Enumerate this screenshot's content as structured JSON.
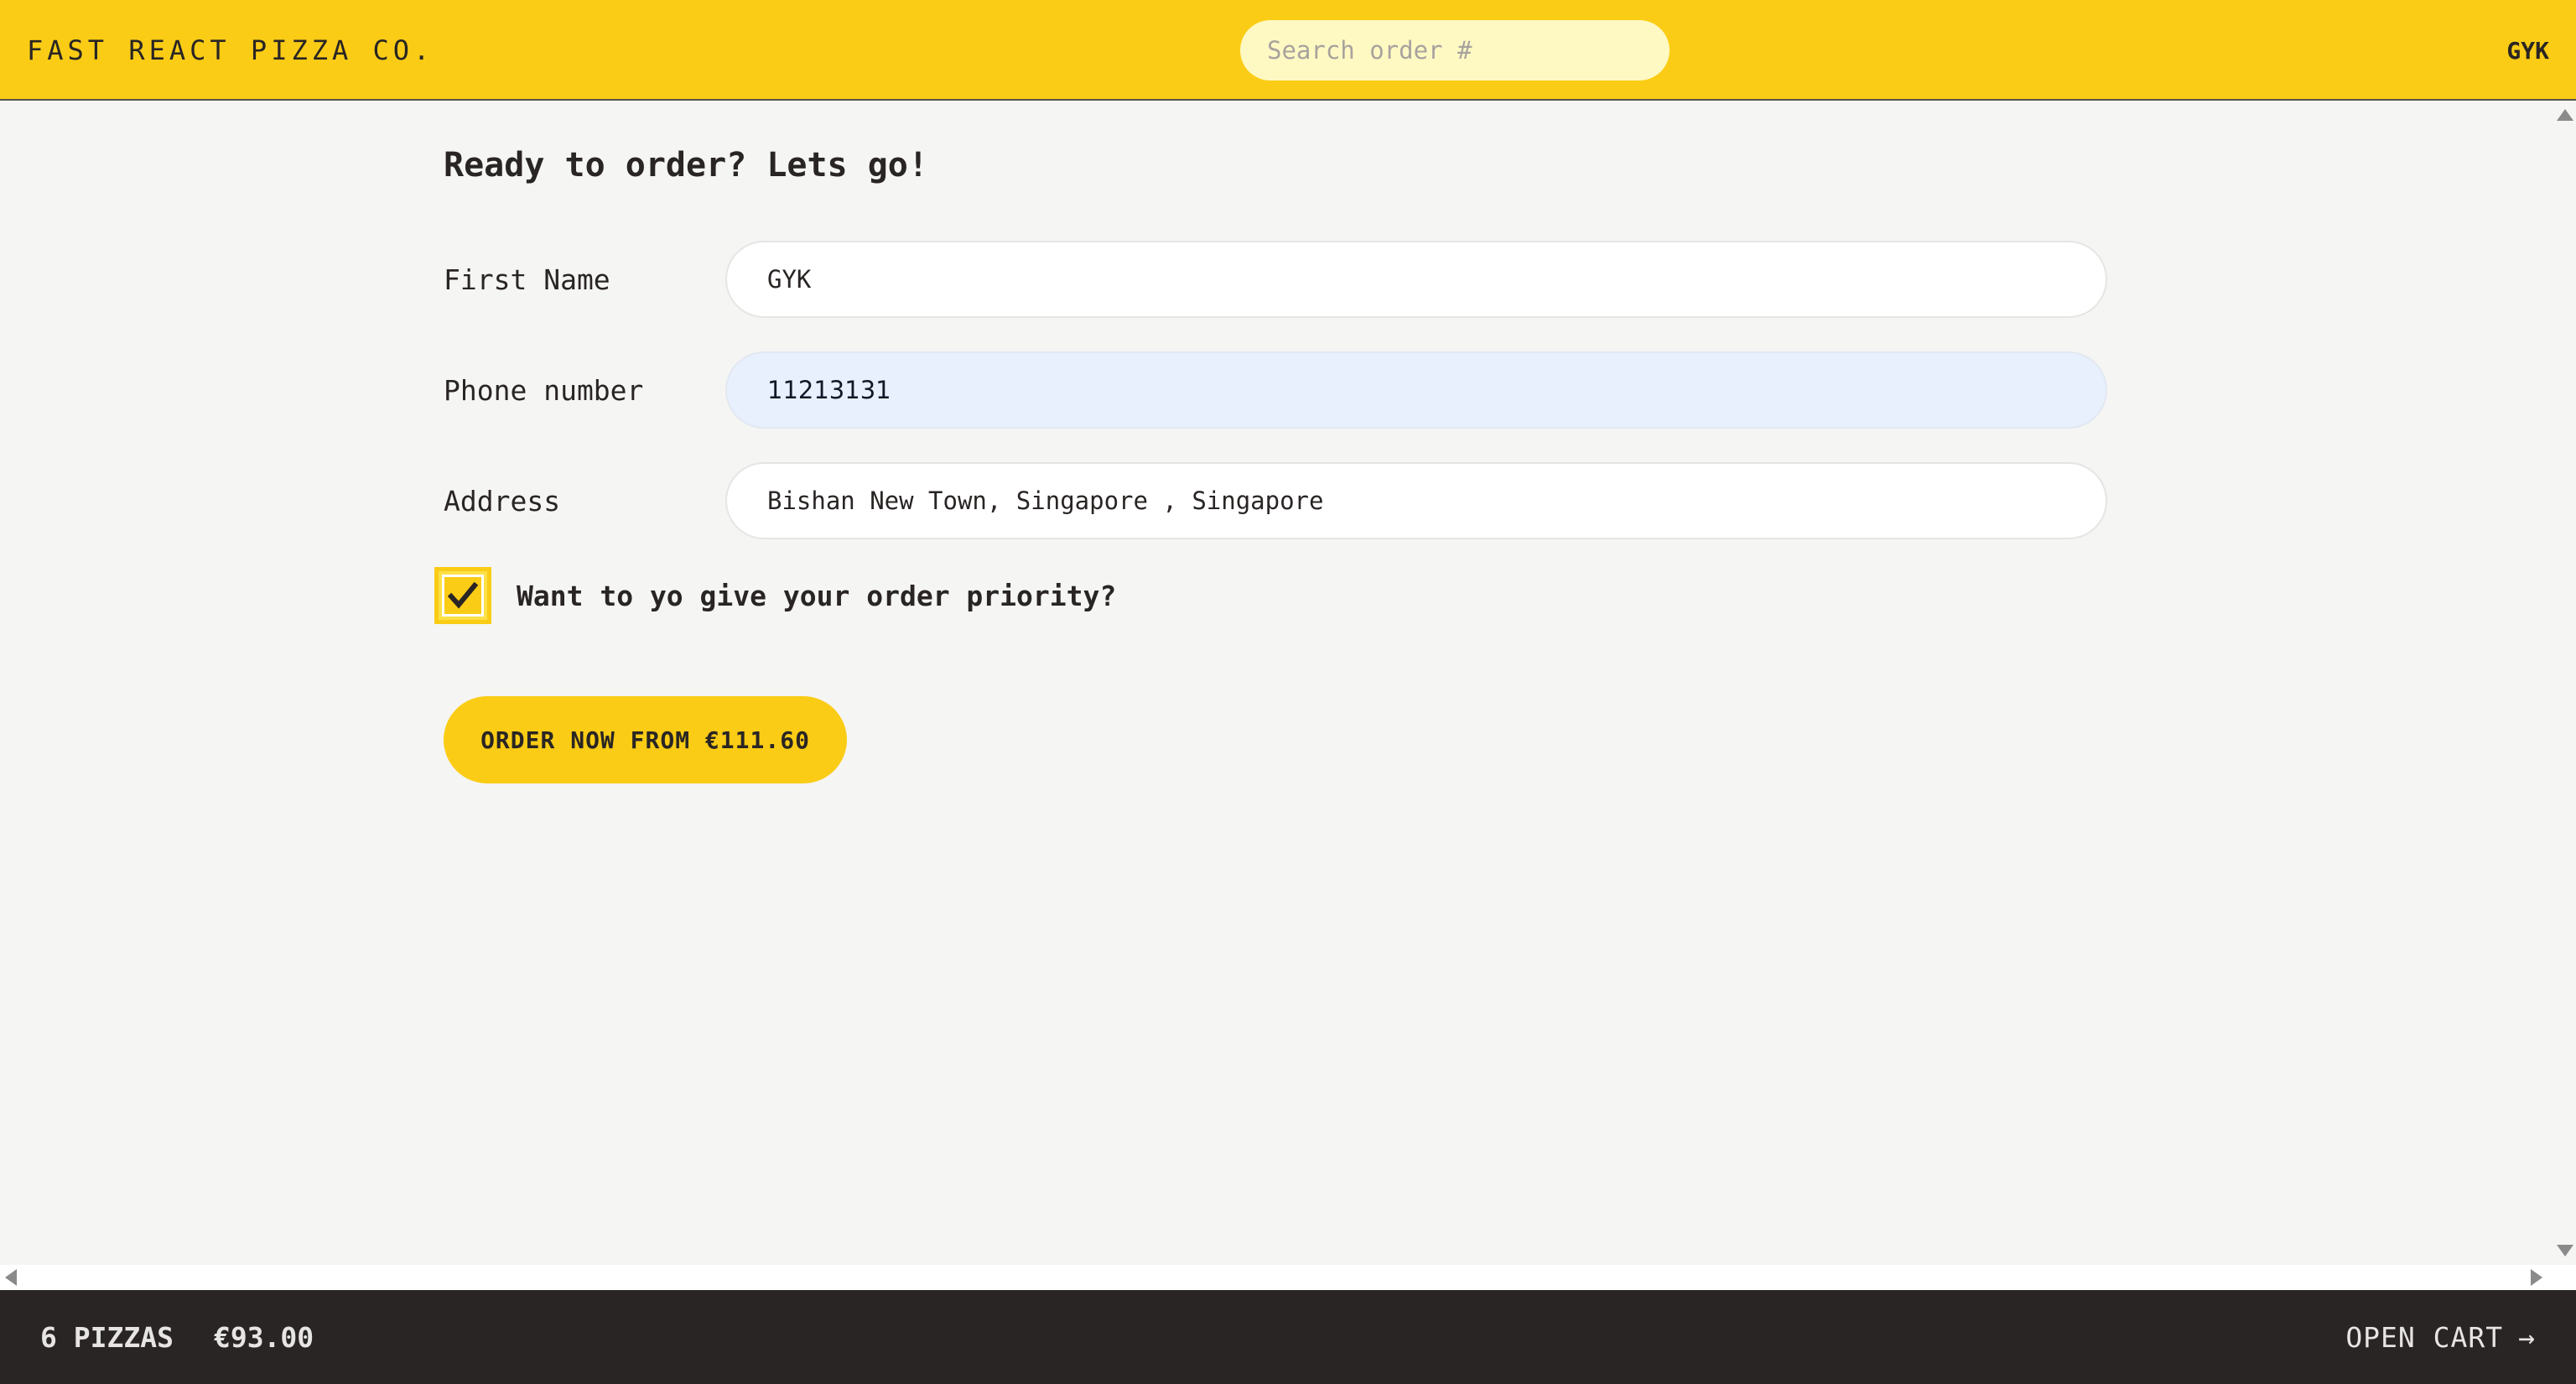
{
  "header": {
    "logo": "FAST REACT PIZZA CO.",
    "search_placeholder": "Search order #",
    "username": "GYK"
  },
  "form": {
    "title": "Ready to order? Lets go!",
    "first_name": {
      "label": "First Name",
      "value": "GYK"
    },
    "phone": {
      "label": "Phone number",
      "value": "11213131"
    },
    "address": {
      "label": "Address",
      "value": "Bishan New Town, Singapore , Singapore"
    },
    "priority": {
      "label": "Want to yo give your order priority?",
      "checked": true
    },
    "submit_label": "ORDER NOW FROM €111.60"
  },
  "footer": {
    "pizza_count": "6 PIZZAS",
    "total": "€93.00",
    "open_cart_label": "OPEN CART",
    "open_cart_arrow": "→"
  },
  "colors": {
    "accent": "#facc15",
    "dark": "#292524",
    "background": "#f5f5f4"
  }
}
